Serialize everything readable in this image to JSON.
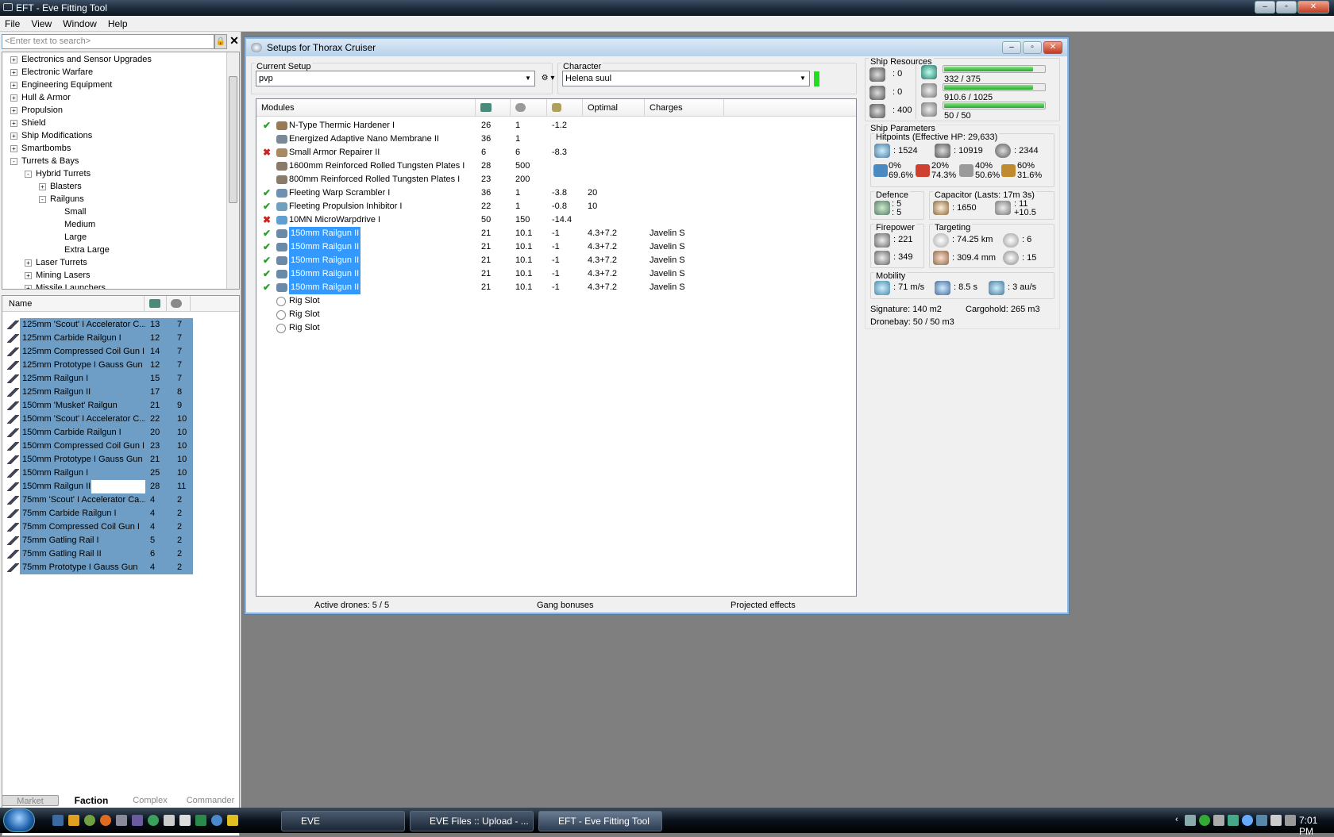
{
  "app": {
    "title": "EFT - Eve Fitting Tool",
    "menu": [
      "File",
      "View",
      "Window",
      "Help"
    ]
  },
  "left": {
    "search_placeholder": "<Enter text to search>",
    "tree": [
      {
        "label": "Electronics and Sensor Upgrades",
        "level": 0,
        "toggle": "+"
      },
      {
        "label": "Electronic Warfare",
        "level": 0,
        "toggle": "+"
      },
      {
        "label": "Engineering Equipment",
        "level": 0,
        "toggle": "+"
      },
      {
        "label": "Hull & Armor",
        "level": 0,
        "toggle": "+"
      },
      {
        "label": "Propulsion",
        "level": 0,
        "toggle": "+"
      },
      {
        "label": "Shield",
        "level": 0,
        "toggle": "+"
      },
      {
        "label": "Ship Modifications",
        "level": 0,
        "toggle": "+"
      },
      {
        "label": "Smartbombs",
        "level": 0,
        "toggle": "+"
      },
      {
        "label": "Turrets & Bays",
        "level": 0,
        "toggle": "-"
      },
      {
        "label": "Hybrid Turrets",
        "level": 1,
        "toggle": "-"
      },
      {
        "label": "Blasters",
        "level": 2,
        "toggle": "+"
      },
      {
        "label": "Railguns",
        "level": 2,
        "toggle": "-"
      },
      {
        "label": "Small",
        "level": 3,
        "toggle": ""
      },
      {
        "label": "Medium",
        "level": 3,
        "toggle": ""
      },
      {
        "label": "Large",
        "level": 3,
        "toggle": ""
      },
      {
        "label": "Extra Large",
        "level": 3,
        "toggle": ""
      },
      {
        "label": "Laser Turrets",
        "level": 1,
        "toggle": "+"
      },
      {
        "label": "Mining Lasers",
        "level": 1,
        "toggle": "+"
      },
      {
        "label": "Missile Launchers",
        "level": 1,
        "toggle": "+"
      }
    ],
    "list_header": "Name",
    "items": [
      {
        "name": "125mm 'Scout' I Accelerator C...",
        "cpu": "13",
        "pg": "7"
      },
      {
        "name": "125mm Carbide Railgun I",
        "cpu": "12",
        "pg": "7"
      },
      {
        "name": "125mm Compressed Coil Gun I",
        "cpu": "14",
        "pg": "7"
      },
      {
        "name": "125mm Prototype I Gauss Gun",
        "cpu": "12",
        "pg": "7"
      },
      {
        "name": "125mm Railgun I",
        "cpu": "15",
        "pg": "7"
      },
      {
        "name": "125mm Railgun II",
        "cpu": "17",
        "pg": "8"
      },
      {
        "name": "150mm 'Musket' Railgun",
        "cpu": "21",
        "pg": "9"
      },
      {
        "name": "150mm 'Scout' I Accelerator C...",
        "cpu": "22",
        "pg": "10"
      },
      {
        "name": "150mm Carbide Railgun I",
        "cpu": "20",
        "pg": "10"
      },
      {
        "name": "150mm Compressed Coil Gun I",
        "cpu": "23",
        "pg": "10"
      },
      {
        "name": "150mm Prototype I Gauss Gun",
        "cpu": "21",
        "pg": "10"
      },
      {
        "name": "150mm Railgun I",
        "cpu": "25",
        "pg": "10"
      },
      {
        "name": "150mm Railgun II",
        "cpu": "28",
        "pg": "11"
      },
      {
        "name": "75mm 'Scout' I Accelerator Ca...",
        "cpu": "4",
        "pg": "2"
      },
      {
        "name": "75mm Carbide Railgun I",
        "cpu": "4",
        "pg": "2"
      },
      {
        "name": "75mm Compressed Coil Gun I",
        "cpu": "4",
        "pg": "2"
      },
      {
        "name": "75mm Gatling Rail I",
        "cpu": "5",
        "pg": "2"
      },
      {
        "name": "75mm Gatling Rail II",
        "cpu": "6",
        "pg": "2"
      },
      {
        "name": "75mm Prototype I Gauss Gun",
        "cpu": "4",
        "pg": "2"
      }
    ],
    "tabs": [
      "Market",
      "Faction",
      "Complex",
      "Commander"
    ]
  },
  "setup": {
    "title": "Setups for Thorax Cruiser",
    "current_setup_label": "Current Setup",
    "current_setup": "pvp",
    "character_label": "Character",
    "character": "Helena suul",
    "columns": [
      "Modules",
      "",
      "",
      "",
      "Optimal",
      "Charges"
    ],
    "modules": [
      {
        "status": "ok",
        "name": "N-Type Thermic Hardener I",
        "cpu": "26",
        "pg": "1",
        "cap": "-1.2",
        "optimal": "",
        "charges": "",
        "sel": false,
        "icon": "#9a7a55"
      },
      {
        "status": "",
        "name": "Energized Adaptive Nano Membrane II",
        "cpu": "36",
        "pg": "1",
        "cap": "",
        "optimal": "",
        "charges": "",
        "sel": false,
        "icon": "#7a8898"
      },
      {
        "status": "x",
        "name": "Small Armor Repairer II",
        "cpu": "6",
        "pg": "6",
        "cap": "-8.3",
        "optimal": "",
        "charges": "",
        "sel": false,
        "icon": "#a88a60"
      },
      {
        "status": "",
        "name": "1600mm Reinforced Rolled Tungsten Plates I",
        "cpu": "28",
        "pg": "500",
        "cap": "",
        "optimal": "",
        "charges": "",
        "sel": false,
        "icon": "#8a7a6a"
      },
      {
        "status": "",
        "name": "800mm Reinforced Rolled Tungsten Plates I",
        "cpu": "23",
        "pg": "200",
        "cap": "",
        "optimal": "",
        "charges": "",
        "sel": false,
        "icon": "#8a7a6a"
      },
      {
        "status": "ok",
        "name": "Fleeting Warp Scrambler I",
        "cpu": "36",
        "pg": "1",
        "cap": "-3.8",
        "optimal": "20",
        "charges": "",
        "sel": false,
        "icon": "#7090b0"
      },
      {
        "status": "ok",
        "name": "Fleeting Propulsion Inhibitor I",
        "cpu": "22",
        "pg": "1",
        "cap": "-0.8",
        "optimal": "10",
        "charges": "",
        "sel": false,
        "icon": "#70a0c0"
      },
      {
        "status": "x",
        "name": "10MN MicroWarpdrive I",
        "cpu": "50",
        "pg": "150",
        "cap": "-14.4",
        "optimal": "",
        "charges": "",
        "sel": false,
        "icon": "#60a0d0"
      },
      {
        "status": "ok",
        "name": "150mm Railgun II",
        "cpu": "21",
        "pg": "10.1",
        "cap": "-1",
        "optimal": "4.3+7.2",
        "charges": "Javelin S",
        "sel": true,
        "icon": "#6a8aa8"
      },
      {
        "status": "ok",
        "name": "150mm Railgun II",
        "cpu": "21",
        "pg": "10.1",
        "cap": "-1",
        "optimal": "4.3+7.2",
        "charges": "Javelin S",
        "sel": true,
        "icon": "#6a8aa8"
      },
      {
        "status": "ok",
        "name": "150mm Railgun II",
        "cpu": "21",
        "pg": "10.1",
        "cap": "-1",
        "optimal": "4.3+7.2",
        "charges": "Javelin S",
        "sel": true,
        "icon": "#6a8aa8"
      },
      {
        "status": "ok",
        "name": "150mm Railgun II",
        "cpu": "21",
        "pg": "10.1",
        "cap": "-1",
        "optimal": "4.3+7.2",
        "charges": "Javelin S",
        "sel": true,
        "icon": "#6a8aa8"
      },
      {
        "status": "ok",
        "name": "150mm Railgun II",
        "cpu": "21",
        "pg": "10.1",
        "cap": "-1",
        "optimal": "4.3+7.2",
        "charges": "Javelin S",
        "sel": true,
        "icon": "#6a8aa8"
      },
      {
        "status": "",
        "name": "Rig Slot",
        "cpu": "",
        "pg": "",
        "cap": "",
        "optimal": "",
        "charges": "",
        "sel": false,
        "icon": "rig"
      },
      {
        "status": "",
        "name": "Rig Slot",
        "cpu": "",
        "pg": "",
        "cap": "",
        "optimal": "",
        "charges": "",
        "sel": false,
        "icon": "rig"
      },
      {
        "status": "",
        "name": "Rig Slot",
        "cpu": "",
        "pg": "",
        "cap": "",
        "optimal": "",
        "charges": "",
        "sel": false,
        "icon": "rig"
      }
    ],
    "status": {
      "drones": "Active drones: 5 / 5",
      "gang": "Gang bonuses",
      "projected": "Projected effects"
    }
  },
  "resources": {
    "label": "Ship Resources",
    "turret_hardpoints": ": 0",
    "launcher_hardpoints": ": 0",
    "calibration": ": 400",
    "cpu": "332 / 375",
    "cpu_fill": 0.885,
    "powergrid": "910.6 / 1025",
    "pg_fill": 0.888,
    "drone_bandwidth": "50 / 50",
    "bw_fill": 1.0
  },
  "params": {
    "label": "Ship Parameters",
    "hp_label": "Hitpoints (Effective HP: 29,633)",
    "shield": ": 1524",
    "armor": ": 10919",
    "structure": ": 2344",
    "res": [
      {
        "top": "0%",
        "bot": "69.6%"
      },
      {
        "top": "20%",
        "bot": "74.3%"
      },
      {
        "top": "40%",
        "bot": "50.6%"
      },
      {
        "top": "60%",
        "bot": "31.6%"
      }
    ],
    "defence_label": "Defence",
    "def1": ": 5",
    "def2": ": 5",
    "cap_label": "Capacitor (Lasts: 17m 3s)",
    "cap_amount": ": 1650",
    "cap_recharge1": ": 11",
    "cap_recharge2": "+10.5",
    "fire_label": "Firepower",
    "dps1": ": 221",
    "dps2": ": 349",
    "targ_label": "Targeting",
    "targ_range": ": 74.25 km",
    "targ_max": ": 6",
    "scan_res": ": 309.4 mm",
    "sensor": ": 15",
    "mob_label": "Mobility",
    "speed": ": 71 m/s",
    "align": ": 8.5 s",
    "warp": ": 3 au/s",
    "signature": "Signature: 140 m2",
    "cargohold": "Cargohold: 265 m3",
    "dronebay": "Dronebay: 50 / 50 m3"
  },
  "taskbar": {
    "tasks": [
      "EVE",
      "EVE Files :: Upload - ...",
      "EFT - Eve Fitting Tool"
    ],
    "clock": "7:01 PM"
  }
}
